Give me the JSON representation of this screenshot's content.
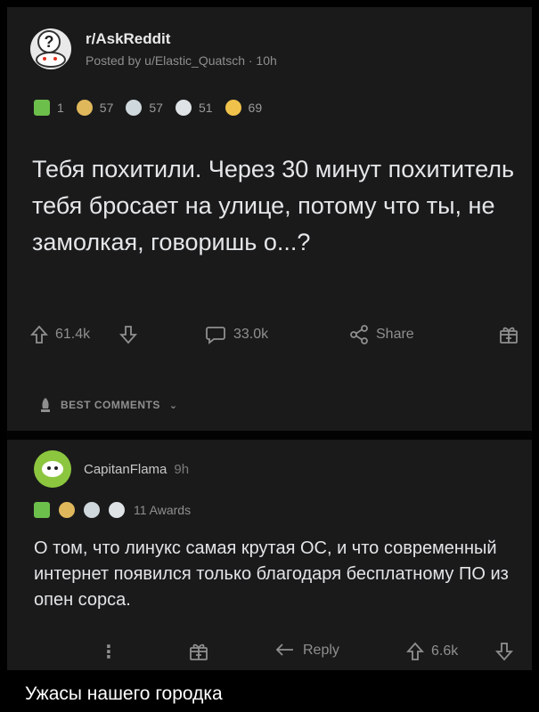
{
  "post": {
    "subreddit": "r/AskReddit",
    "posted_by": "Posted by u/Elastic_Quatsch · 10h",
    "awards": [
      {
        "icon": "rocket-award-icon",
        "count": "1",
        "color": "#6dbf4b"
      },
      {
        "icon": "wholesome-award-icon",
        "count": "57",
        "color": "#e0b85c"
      },
      {
        "icon": "helpful-award-icon",
        "count": "57",
        "color": "#cfd8dc"
      },
      {
        "icon": "silver-award-icon",
        "count": "51",
        "color": "#dfe3e6"
      },
      {
        "icon": "laughing-award-icon",
        "count": "69",
        "color": "#f0c24b"
      }
    ],
    "title": "Тебя похитили. Через 30 минут похититель тебя бросает на улице, потому что ты, не замолкая, говоришь о...?",
    "upvotes": "61.4k",
    "comments": "33.0k",
    "share_label": "Share"
  },
  "sort": {
    "label": "BEST COMMENTS"
  },
  "comment": {
    "author": "CapitanFlama",
    "time": "9h",
    "awards_label": "11 Awards",
    "body": "О том, что линукс самая крутая ОС, и что современный интернет появился только благодаря бесплатному ПО из опен сорса.",
    "reply_label": "Reply",
    "votes": "6.6k"
  },
  "caption": "Ужасы нашего городка"
}
